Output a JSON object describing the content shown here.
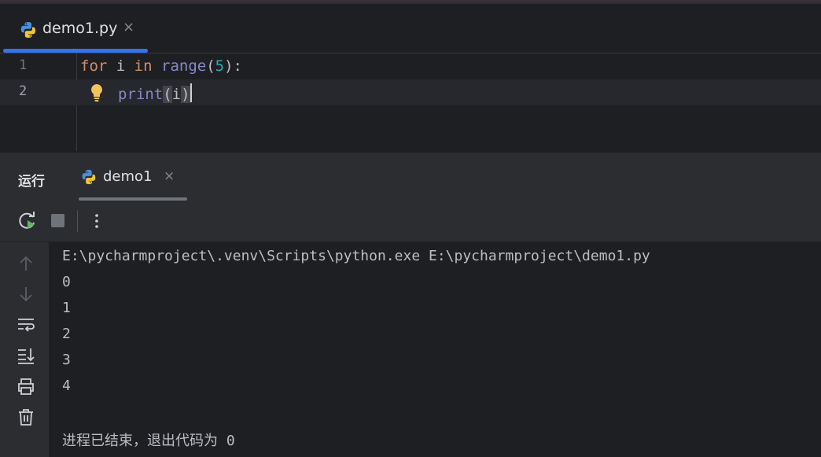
{
  "editor": {
    "tab_label": "demo1.py",
    "tab_close": "×",
    "lines": [
      {
        "number": "1"
      },
      {
        "number": "2"
      }
    ],
    "line1": {
      "kw_for": "for",
      "var": " i ",
      "kw_in": "in",
      "space": " ",
      "fn": "range",
      "open": "(",
      "num": "5",
      "close": "):"
    },
    "line2": {
      "fn": "print",
      "open": "(",
      "arg": "i",
      "close": ")"
    }
  },
  "run_panel": {
    "title": "运行",
    "tab_label": "demo1",
    "tab_close": "×",
    "toolbar": {
      "rerun_icon": "rerun-icon",
      "stop_icon": "stop-icon",
      "more_icon": "more-vertical-icon"
    },
    "side_icons": [
      "arrow-up-icon",
      "arrow-down-icon",
      "soft-wrap-icon",
      "scroll-to-end-icon",
      "print-icon",
      "trash-icon"
    ],
    "console": {
      "command": "E:\\pycharmproject\\.venv\\Scripts\\python.exe E:\\pycharmproject\\demo1.py",
      "output": [
        "0",
        "1",
        "2",
        "3",
        "4"
      ],
      "exit_message": "进程已结束，退出代码为 0"
    }
  },
  "colors": {
    "accent": "#3574f0",
    "keyword": "#cf8e6d",
    "builtin": "#8888c6",
    "number": "#2aacb8",
    "background": "#1e1f22",
    "panel": "#2b2d30"
  }
}
